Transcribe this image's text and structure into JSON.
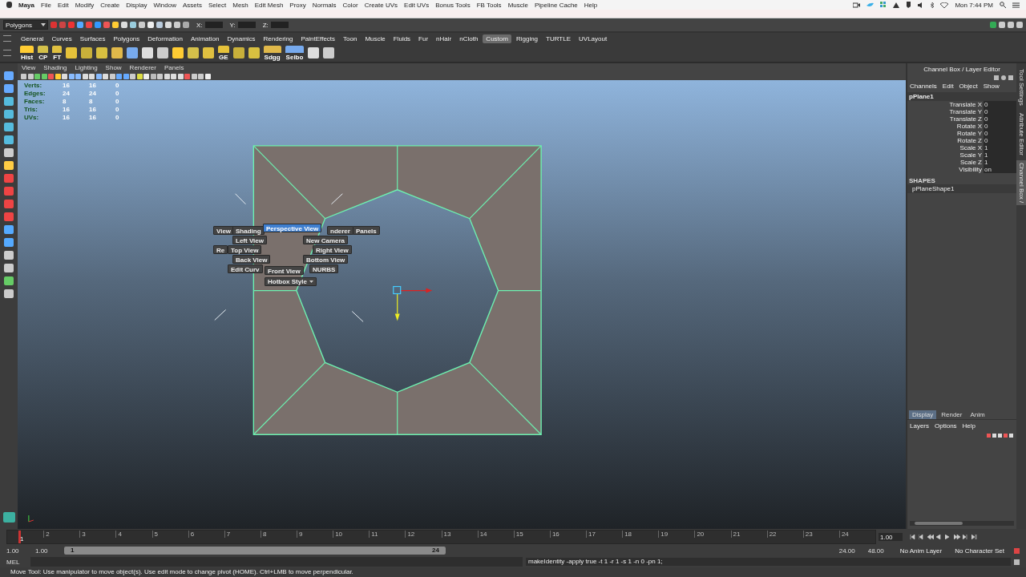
{
  "menu_bar": {
    "app": "Maya",
    "items": [
      "File",
      "Edit",
      "Modify",
      "Create",
      "Display",
      "Window",
      "Assets",
      "Select",
      "Mesh",
      "Edit Mesh",
      "Proxy",
      "Normals",
      "Color",
      "Create UVs",
      "Edit UVs",
      "Bonus Tools",
      "FB Tools",
      "Muscle",
      "Pipeline Cache",
      "Help"
    ],
    "clock": "Mon 7:44 PM"
  },
  "toolbar": {
    "mode": "Polygons",
    "fields": [
      "X:",
      "Y:",
      "Z:"
    ]
  },
  "shelf": {
    "tabs": [
      {
        "label": "General",
        "selected": false
      },
      {
        "label": "Curves",
        "selected": false
      },
      {
        "label": "Surfaces",
        "selected": false
      },
      {
        "label": "Polygons",
        "selected": false
      },
      {
        "label": "Deformation",
        "selected": false
      },
      {
        "label": "Animation",
        "selected": false
      },
      {
        "label": "Dynamics",
        "selected": false
      },
      {
        "label": "Rendering",
        "selected": false
      },
      {
        "label": "PaintEffects",
        "selected": false
      },
      {
        "label": "Toon",
        "selected": false
      },
      {
        "label": "Muscle",
        "selected": false
      },
      {
        "label": "Fluids",
        "selected": false
      },
      {
        "label": "Fur",
        "selected": false
      },
      {
        "label": "nHair",
        "selected": false
      },
      {
        "label": "nCloth",
        "selected": false
      },
      {
        "label": "Custom",
        "selected": true
      },
      {
        "label": "Rigging",
        "selected": false
      },
      {
        "label": "TURTLE",
        "selected": false
      },
      {
        "label": "UVLayout",
        "selected": false
      }
    ],
    "buttons": [
      {
        "kind": "labeled",
        "label": "Hist"
      },
      {
        "kind": "labeled",
        "label": "CP"
      },
      {
        "kind": "labeled",
        "label": "FT"
      },
      {
        "kind": "plain"
      },
      {
        "kind": "plain"
      },
      {
        "kind": "plain"
      },
      {
        "kind": "plain"
      },
      {
        "kind": "plain"
      },
      {
        "kind": "plain"
      },
      {
        "kind": "plain"
      },
      {
        "kind": "plain"
      },
      {
        "kind": "plain"
      },
      {
        "kind": "plain"
      },
      {
        "kind": "labeled",
        "label": "GE"
      },
      {
        "kind": "plain"
      },
      {
        "kind": "plain"
      },
      {
        "kind": "labeled",
        "label": "Sdgg"
      },
      {
        "kind": "labeled",
        "label": "Selbo"
      },
      {
        "kind": "plain"
      },
      {
        "kind": "plain"
      }
    ]
  },
  "panel_menu": [
    "View",
    "Shading",
    "Lighting",
    "Show",
    "Renderer",
    "Panels"
  ],
  "hud": [
    {
      "label": "Verts:",
      "values": [
        "16",
        "16",
        "0"
      ]
    },
    {
      "label": "Edges:",
      "values": [
        "24",
        "24",
        "0"
      ]
    },
    {
      "label": "Faces:",
      "values": [
        "8",
        "8",
        "0"
      ]
    },
    {
      "label": "Tris:",
      "values": [
        "16",
        "16",
        "0"
      ]
    },
    {
      "label": "UVs:",
      "values": [
        "16",
        "16",
        "0"
      ]
    }
  ],
  "hotbox": {
    "items": [
      {
        "label": "View",
        "selected": false
      },
      {
        "label": "Shading",
        "selected": false
      },
      {
        "label": "Perspective View",
        "selected": true
      },
      {
        "label": "nderer",
        "selected": false
      },
      {
        "label": "Panels",
        "selected": false
      },
      {
        "label": "Left View",
        "selected": false
      },
      {
        "label": "New Camera",
        "selected": false
      },
      {
        "label": "Re",
        "selected": false
      },
      {
        "label": "Top View",
        "selected": false
      },
      {
        "label": "Right View",
        "selected": false
      },
      {
        "label": "Back View",
        "selected": false
      },
      {
        "label": "Bottom View",
        "selected": false
      },
      {
        "label": "Edit Curv",
        "selected": false
      },
      {
        "label": "NURBS",
        "selected": false
      },
      {
        "label": "Front View",
        "selected": false
      }
    ],
    "style_button": "Hotbox Style"
  },
  "channel_box": {
    "title": "Channel Box / Layer Editor",
    "menus": [
      "Channels",
      "Edit",
      "Object",
      "Show"
    ],
    "object": "pPlane1",
    "attributes": [
      {
        "name": "Translate X",
        "value": "0"
      },
      {
        "name": "Translate Y",
        "value": "0"
      },
      {
        "name": "Translate Z",
        "value": "0"
      },
      {
        "name": "Rotate X",
        "value": "0"
      },
      {
        "name": "Rotate Y",
        "value": "0"
      },
      {
        "name": "Rotate Z",
        "value": "0"
      },
      {
        "name": "Scale X",
        "value": "1"
      },
      {
        "name": "Scale Y",
        "value": "1"
      },
      {
        "name": "Scale Z",
        "value": "1"
      },
      {
        "name": "Visibility",
        "value": "on"
      }
    ],
    "shapes_heading": "SHAPES",
    "shape": "pPlaneShape1"
  },
  "side_tabs": [
    {
      "label": "Tool Settings",
      "selected": false
    },
    {
      "label": "Attribute Editor",
      "selected": false
    },
    {
      "label": "Channel Box /",
      "selected": true
    }
  ],
  "layer_editor": {
    "tabs": [
      {
        "label": "Display",
        "selected": true
      },
      {
        "label": "Render",
        "selected": false
      },
      {
        "label": "Anim",
        "selected": false
      }
    ],
    "menus": [
      "Layers",
      "Options",
      "Help"
    ]
  },
  "timeline": {
    "current": "1",
    "level": 0,
    "ticks": [
      "2",
      "3",
      "4",
      "5",
      "6",
      "7",
      "8",
      "9",
      "10",
      "11",
      "12",
      "13",
      "14",
      "15",
      "16",
      "17",
      "18",
      "19",
      "20",
      "21",
      "22",
      "23",
      "24"
    ],
    "frame_field": "1.00"
  },
  "range": {
    "start": "1.00",
    "range_start": "1.00",
    "slider_start": "1",
    "slider_end": "24",
    "level": 1,
    "range_end": "24.00",
    "end": "48.00",
    "anim_layer": "No Anim Layer",
    "character_set": "No Character Set"
  },
  "command_line": {
    "language": "MEL",
    "result": "makeIdentity -apply true -t 1 -r 1 -s 1 -n 0 -pn 1;"
  },
  "help_line": "Move Tool: Use manipulator to move object(s). Use edit mode to change pivot (HOME).  Ctrl+LMB to move perpendicular."
}
